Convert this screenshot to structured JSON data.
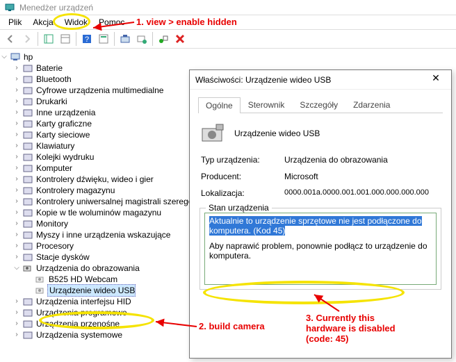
{
  "window": {
    "title": "Menedżer urządzeń"
  },
  "menu": {
    "file": "Plik",
    "action": "Akcja",
    "view": "Widok",
    "help": "Pomoc"
  },
  "tree": {
    "root": "hp",
    "items": [
      "Baterie",
      "Bluetooth",
      "Cyfrowe urządzenia multimedialne",
      "Drukarki",
      "Inne urządzenia",
      "Karty graficzne",
      "Karty sieciowe",
      "Klawiatury",
      "Kolejki wydruku",
      "Komputer",
      "Kontrolery dźwięku, wideo i gier",
      "Kontrolery magazynu",
      "Kontrolery uniwersalnej magistrali szeregowej",
      "Kopie w tle woluminów magazynu",
      "Monitory",
      "Myszy i inne urządzenia wskazujące",
      "Procesory",
      "Stacje dysków"
    ],
    "imaging": {
      "label": "Urządzenia do obrazowania",
      "children": [
        "B525 HD Webcam",
        "Urządzenie wideo USB"
      ]
    },
    "tail": [
      "Urządzenia interfejsu HID",
      "Urządzenia programowe",
      "Urządzenia przenośne",
      "Urządzenia systemowe"
    ]
  },
  "dialog": {
    "title": "Właściwości: Urządzenie wideo USB",
    "tabs": {
      "general": "Ogólne",
      "driver": "Sterownik",
      "details": "Szczegóły",
      "events": "Zdarzenia"
    },
    "device_name": "Urządzenie wideo USB",
    "rows": {
      "type_label": "Typ urządzenia:",
      "type_value": "Urządzenia do obrazowania",
      "mfr_label": "Producent:",
      "mfr_value": "Microsoft",
      "loc_label": "Lokalizacja:",
      "loc_value": "0000.001a.0000.001.001.000.000.000.000"
    },
    "status_legend": "Stan urządzenia",
    "status_highlight": "Aktualnie to urządzenie sprzętowe nie jest podłączone do komputera. (Kod 45)",
    "status_rest": "Aby naprawić problem, ponownie podłącz to urządzenie do komputera."
  },
  "annotations": {
    "a1": "1. view > enable hidden",
    "a2": "2. build camera",
    "a3": "3. Currently this\nhardware is disabled\n(code: 45)"
  }
}
